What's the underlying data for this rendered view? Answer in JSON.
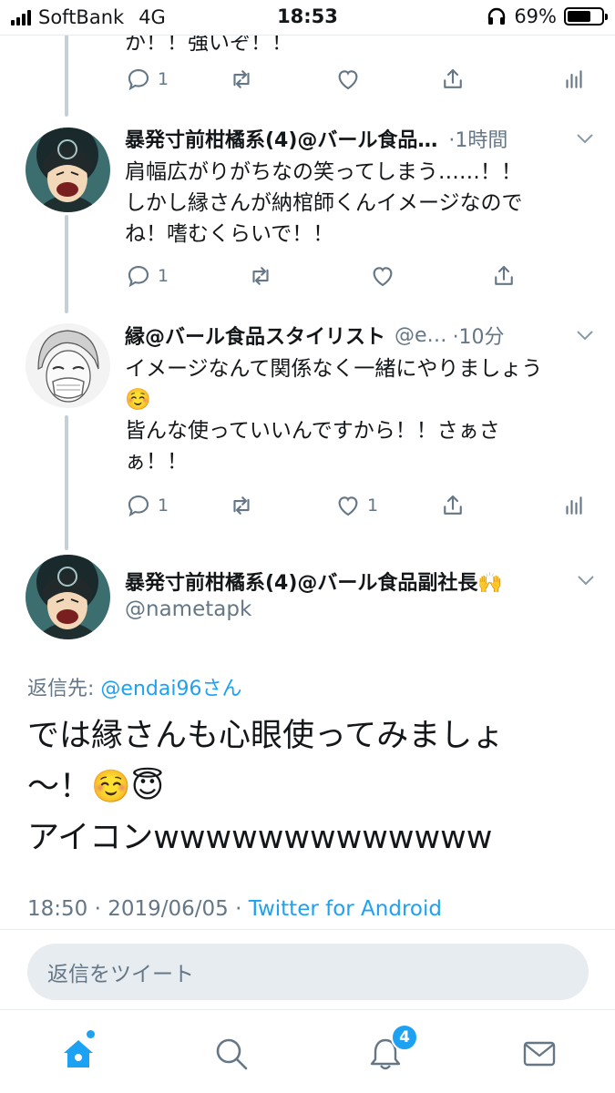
{
  "status_bar": {
    "carrier": "SoftBank",
    "network": "4G",
    "time": "18:53",
    "battery_percent": "69%",
    "battery_level": 0.69,
    "icons": [
      "signal-icon",
      "headphones-icon",
      "battery-icon"
    ]
  },
  "tweets": [
    {
      "text": "か！！強いぞ！！",
      "actions": {
        "reply_count": "1",
        "retweet_count": "",
        "like_count": ""
      }
    },
    {
      "name": "暴発寸前柑橘系(4)@バール食品…",
      "handle": "",
      "time": "·1時間",
      "text": "肩幅広がりがちなの笑ってしまう……！！\nしかし縁さんが納棺師くんイメージなので\nね！嗜むくらいで！！",
      "actions": {
        "reply_count": "1",
        "retweet_count": "",
        "like_count": ""
      }
    },
    {
      "name": "縁@バール食品スタイリスト",
      "handle": "@e…",
      "time": "·10分",
      "text": "イメージなんて関係なく一緒にやりましょう\n☺️\n皆んな使っていいんですから！！さぁさ\nぁ！！",
      "actions": {
        "reply_count": "1",
        "retweet_count": "",
        "like_count": "1"
      }
    }
  ],
  "main_tweet": {
    "name": "暴発寸前柑橘系(4)@バール食品副社長🙌",
    "handle": "@nametapk",
    "reply_to_label": "返信先: ",
    "reply_to_user": "@endai96さん",
    "text": "では縁さんも心眼使ってみましょ\n～！☺️😇\nアイコンwwwwwwwwwwwww",
    "timestamp": "18:50 · 2019/06/05 · ",
    "source": "Twitter for Android"
  },
  "reply_box": {
    "placeholder": "返信をツイート"
  },
  "tab_bar": {
    "tabs": [
      "home-icon",
      "search-icon",
      "notifications-icon",
      "messages-icon"
    ],
    "notifications_badge": "4"
  },
  "colors": {
    "accent": "#1da1f2",
    "secondary_text": "#657786",
    "thread_line": "#c4cfd6"
  }
}
